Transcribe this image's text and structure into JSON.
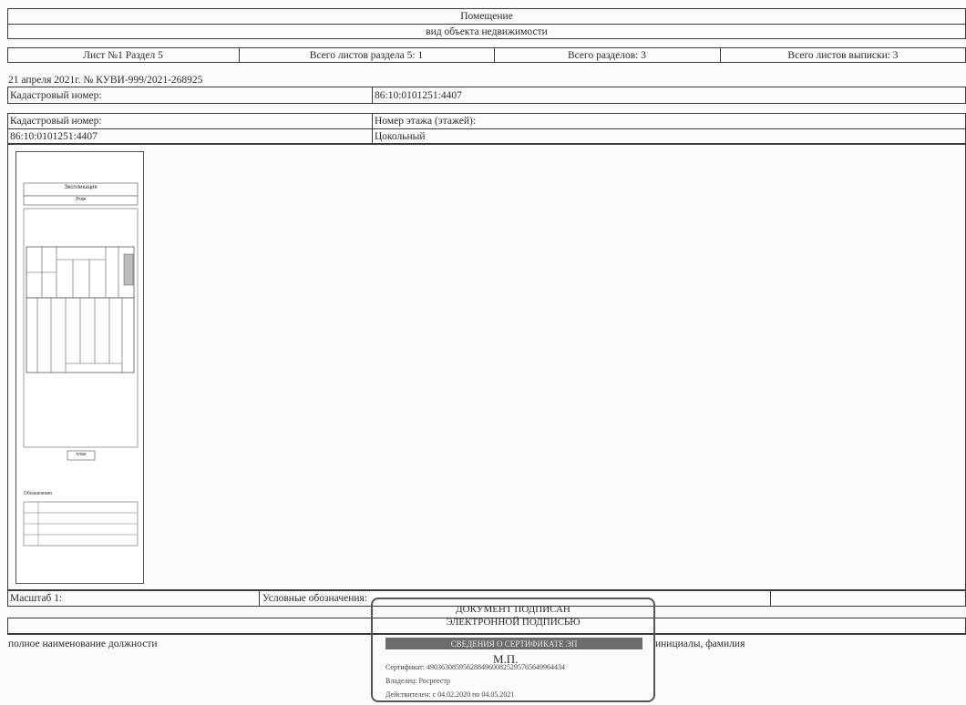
{
  "header": {
    "object_kind": "Помещение",
    "object_kind_caption": "вид объекта недвижимости"
  },
  "sheet_info": {
    "sheet": "Лист №1  Раздел 5",
    "sheets_in_section": "Всего листов раздела 5: 1",
    "sections_total": "Всего разделов: 3",
    "sheets_total": "Всего листов выписки: 3"
  },
  "document_ref": "21 апреля 2021г. № КУВИ-999/2021-268925",
  "cadastre": {
    "label": "Кадастровый номер:",
    "value": "86:10:0101251:4407",
    "label2": "Кадастровый номер:",
    "value2": "86:10:0101251:4407",
    "floor_label": "Номер этажа (этажей):",
    "floor_value": "Цокольный"
  },
  "plan_image": {
    "title": "Экспликация",
    "subtitle": "Этаж",
    "bottom_box": "план",
    "legend_heading": "Обозначения"
  },
  "footer": {
    "scale_label": "Масштаб 1:",
    "legend_label": "Условные обозначения:",
    "position_caption": "полное наименование должности",
    "name_caption": "инициалы, фамилия"
  },
  "signature_stamp": {
    "line1": "ДОКУМЕНТ ПОДПИСАН",
    "line2": "ЭЛЕКТРОННОЙ ПОДПИСЬЮ",
    "cert_bar": "СВЕДЕНИЯ О СЕРТИФИКАТЕ ЭП",
    "seal": "М.П.",
    "certificate": "Сертификат: 49036308595628849600825295765649964434",
    "owner": "Владелец: Росреестр",
    "valid": "Действителен: с 04.02.2020 по 04.05.2021"
  }
}
